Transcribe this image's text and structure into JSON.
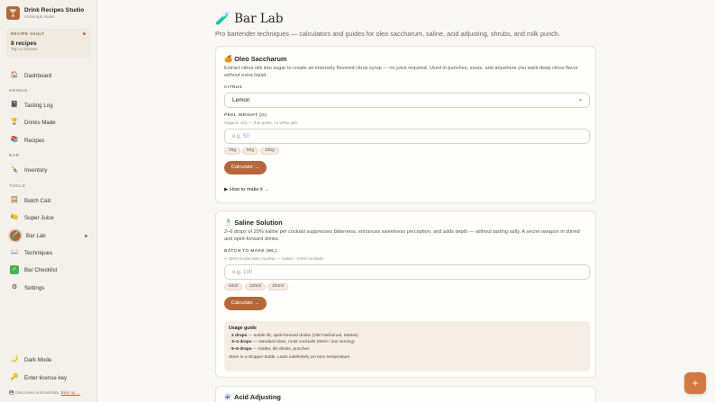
{
  "brand": {
    "title": "Drink Recipes Studio",
    "subtitle": "contamp8.studio",
    "logo_icon": "cocktail-glass-icon"
  },
  "vault": {
    "label": "RECIPE VAULT",
    "count": "8 recipes",
    "hint": "Tap to browse"
  },
  "nav": {
    "dashboard": "Dashboard",
    "section_drinks": "DRINKS",
    "tasting_log": "Tasting Log",
    "drinks_made": "Drinks Made",
    "recipes": "Recipes",
    "section_bar": "BAR",
    "inventory": "Inventory",
    "section_tools": "TOOLS",
    "batch_calc": "Batch Calc",
    "super_juice": "Super Juice",
    "bar_lab": "Bar Lab",
    "techniques": "Techniques",
    "bar_checklist": "Bar Checklist",
    "settings": "Settings",
    "dark_mode": "Dark Mode",
    "license": "Enter license key"
  },
  "footer": {
    "note": "Data saves automatically.",
    "link": "Back up →"
  },
  "page": {
    "title": "Bar Lab",
    "title_icon": "🧪",
    "subtitle": "Pro bartender techniques — calculators and guides for oleo saccharum, saline, acid adjusting, shrubs, and milk punch."
  },
  "oleo": {
    "icon": "🍊",
    "title": "Oleo Saccharum",
    "desc": "Extract citrus oils into sugar to create an intensely flavored citrus syrup — no juice required. Used in punches, sours, and anywhere you want deep citrus flavor without extra liquid.",
    "citrus_label": "CITRUS",
    "citrus_value": "Lemon",
    "peel_label": "PEEL WEIGHT (G)",
    "peel_hint": "Organic only — thin peels, no white pith",
    "peel_placeholder": "e.g. 50",
    "chips": [
      "25g",
      "50g",
      "100g"
    ],
    "calc_label": "Calculate →",
    "howto": "▶  How to make it →"
  },
  "saline": {
    "icon": "🧂",
    "title": "Saline Solution",
    "desc": "2–6 drops of 20% saline per cocktail suppresses bitterness, enhances sweetness perception, and adds depth — without tasting salty. A secret weapon in stirred and spirit-forward drinks.",
    "batch_label": "BATCH TO MAKE (ML)",
    "batch_hint": "A 100ml bottle lasts months — makes ~1000 cocktails",
    "batch_placeholder": "e.g. 100",
    "chips": [
      "50ml",
      "100ml",
      "250ml"
    ],
    "calc_label": "Calculate →",
    "guide_title": "Usage guide",
    "guide_lines": [
      {
        "drops": "2 drops",
        "text": " — subtle lift, spirit-forward drinks (Old Fashioned, Martini)"
      },
      {
        "drops": "3–4 drops",
        "text": " — standard dose, most cocktails (60ml / 2oz serving)"
      },
      {
        "drops": "5–6 drops",
        "text": " — bolder, tiki drinks, punches"
      }
    ],
    "guide_foot": "Store in a dropper bottle. Lasts indefinitely at room temperature."
  },
  "acid": {
    "icon": "⚗️",
    "title": "Acid Adjusting"
  },
  "fab": "+",
  "colors": {
    "accent": "#b5673a",
    "fab": "#d17a43",
    "background": "#faf8f5"
  }
}
